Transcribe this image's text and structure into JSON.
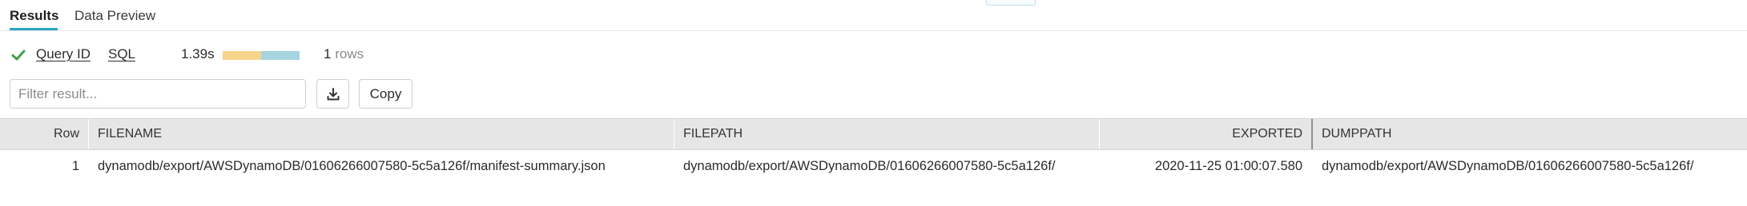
{
  "tabs": [
    {
      "label": "Results",
      "active": true
    },
    {
      "label": "Data Preview",
      "active": false
    }
  ],
  "status": {
    "success": true,
    "query_id_label": "Query ID",
    "sql_label": "SQL",
    "duration": "1.39s",
    "progress_fraction": 0.5,
    "rows_count": "1",
    "rows_unit": "rows"
  },
  "toolbar": {
    "filter_placeholder": "Filter result...",
    "filter_value": "",
    "download_icon": "download-icon",
    "copy_label": "Copy"
  },
  "table": {
    "columns": [
      "Row",
      "FILENAME",
      "FILEPATH",
      "EXPORTED",
      "DUMPPATH"
    ],
    "rows": [
      [
        "1",
        "dynamodb/export/AWSDynamoDB/01606266007580-5c5a126f/manifest-summary.json",
        "dynamodb/export/AWSDynamoDB/01606266007580-5c5a126f/",
        "2020-11-25 01:00:07.580",
        "dynamodb/export/AWSDynamoDB/01606266007580-5c5a126f/"
      ]
    ]
  },
  "colors": {
    "accent": "#29a7c4",
    "success": "#3ea24a",
    "progress_compile": "#f6d48c",
    "progress_execute": "#a6d4de",
    "header_bg": "#e6e6e6"
  }
}
